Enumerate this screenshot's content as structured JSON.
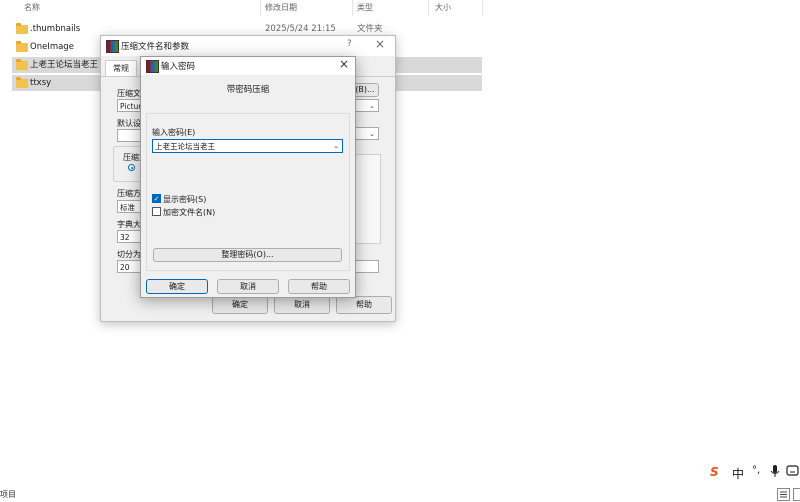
{
  "explorer": {
    "columns": {
      "name": "名称",
      "date": "修改日期",
      "type": "类型",
      "size": "大小"
    },
    "rows": [
      {
        "name": ".thumbnails",
        "date": "2025/5/24 21:15",
        "type": "文件夹",
        "selected": false
      },
      {
        "name": "OneImage",
        "date": "",
        "type": "",
        "selected": false
      },
      {
        "name": "上老王论坛当老王",
        "date": "",
        "type": "",
        "selected": true
      },
      {
        "name": "ttxsy",
        "date": "",
        "type": "",
        "selected": true
      }
    ],
    "status_left": "项目"
  },
  "archive_dialog": {
    "title": "压缩文件名和参数",
    "help_glyph": "?",
    "close_glyph": "×",
    "tab_general": "常规",
    "archive_name_label": "压缩文",
    "archive_name_value": "Picture",
    "browse_button": "(B)...",
    "default_label": "默认设",
    "compress_group_label": "压缩文",
    "method_label": "压缩方",
    "method_value": "标准",
    "dict_label": "字典大",
    "dict_value": "32",
    "split_label": "切分为",
    "split_value": "20",
    "ok": "确定",
    "cancel": "取消",
    "help": "帮助"
  },
  "password_dialog": {
    "title": "输入密码",
    "close_glyph": "×",
    "heading": "带密码压缩",
    "enter_label": "输入密码(E)",
    "password_value": "上老王论坛当老王",
    "show_password_label": "显示密码(S)",
    "show_password_checked": true,
    "encrypt_names_label": "加密文件名(N)",
    "encrypt_names_checked": false,
    "organize_button": "整理密码(O)...",
    "ok": "确定",
    "cancel": "取消",
    "help": "帮助"
  },
  "taskbar": {
    "ime_logo": "S",
    "ime_lang": "中",
    "ime_punct": "°,",
    "mic_icon": "mic-icon",
    "keyboard_icon": "keyboard-icon"
  },
  "colors": {
    "accent": "#0067c0",
    "selected_row": "#d9d9d9",
    "ime_logo": "#e8541e"
  }
}
